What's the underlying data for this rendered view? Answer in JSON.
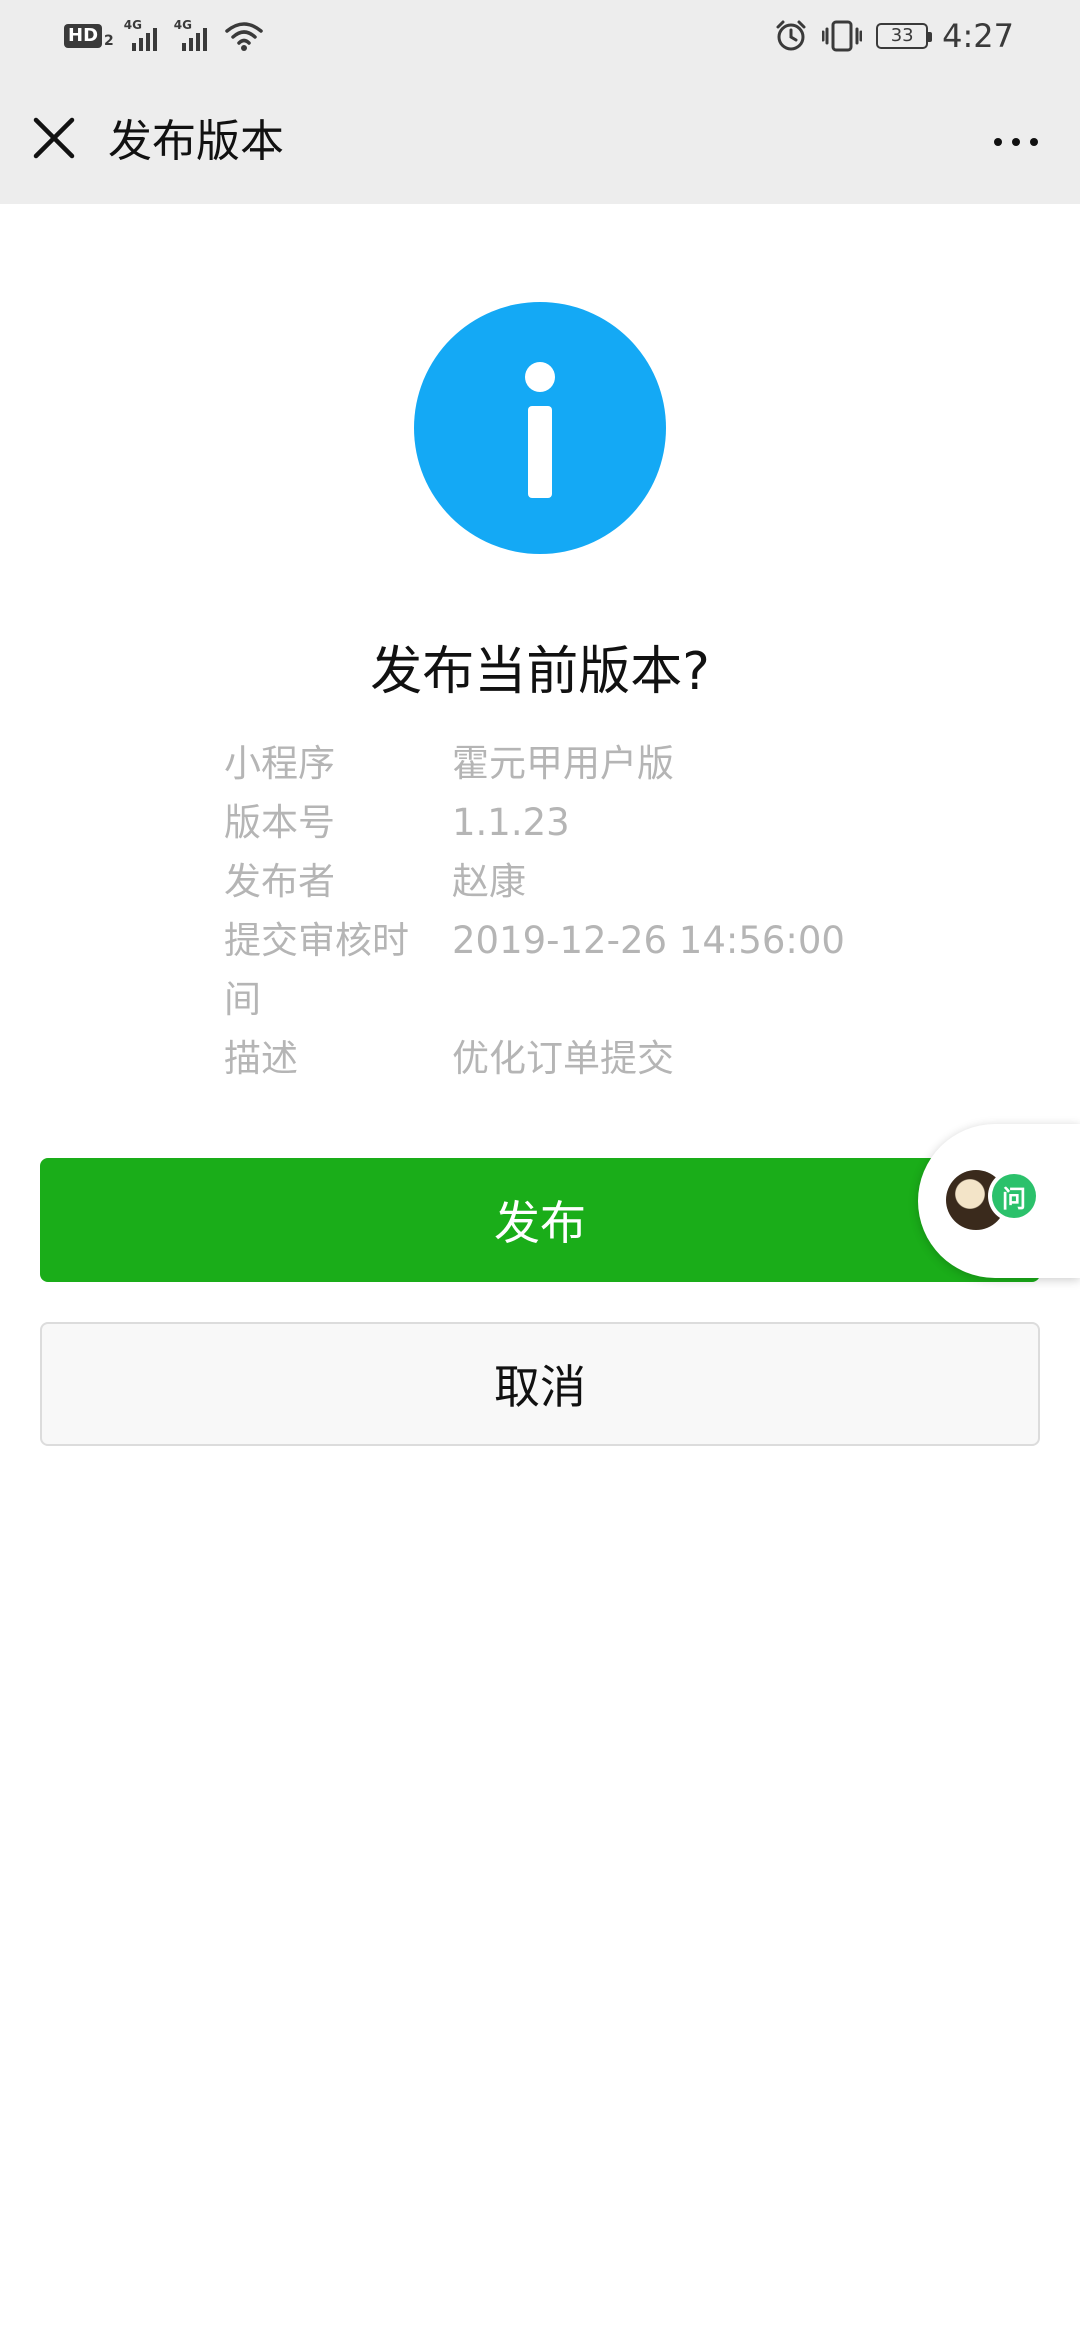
{
  "status_bar": {
    "hd_label": "HD",
    "hd_sub": "2",
    "network_1": "4G",
    "network_2": "4G",
    "battery_level": "33",
    "time": "4:27"
  },
  "nav": {
    "title": "发布版本",
    "close_icon": "close-icon",
    "more_icon": "more-icon"
  },
  "dialog": {
    "icon": "info-icon",
    "icon_color": "#14a9f5",
    "title": "发布当前版本?",
    "details": [
      {
        "label": "小程序",
        "value": "霍元甲用户版"
      },
      {
        "label": "版本号",
        "value": "1.1.23"
      },
      {
        "label": "发布者",
        "value": "赵康"
      },
      {
        "label": "提交审核时间",
        "value": "2019-12-26 14:56:00"
      },
      {
        "label": "描述",
        "value": "优化订单提交"
      }
    ]
  },
  "buttons": {
    "publish_label": "发布",
    "publish_color": "#1aad19",
    "cancel_label": "取消"
  },
  "floating_widget": {
    "badge_text": "问",
    "badge_color": "#2bc16b"
  }
}
